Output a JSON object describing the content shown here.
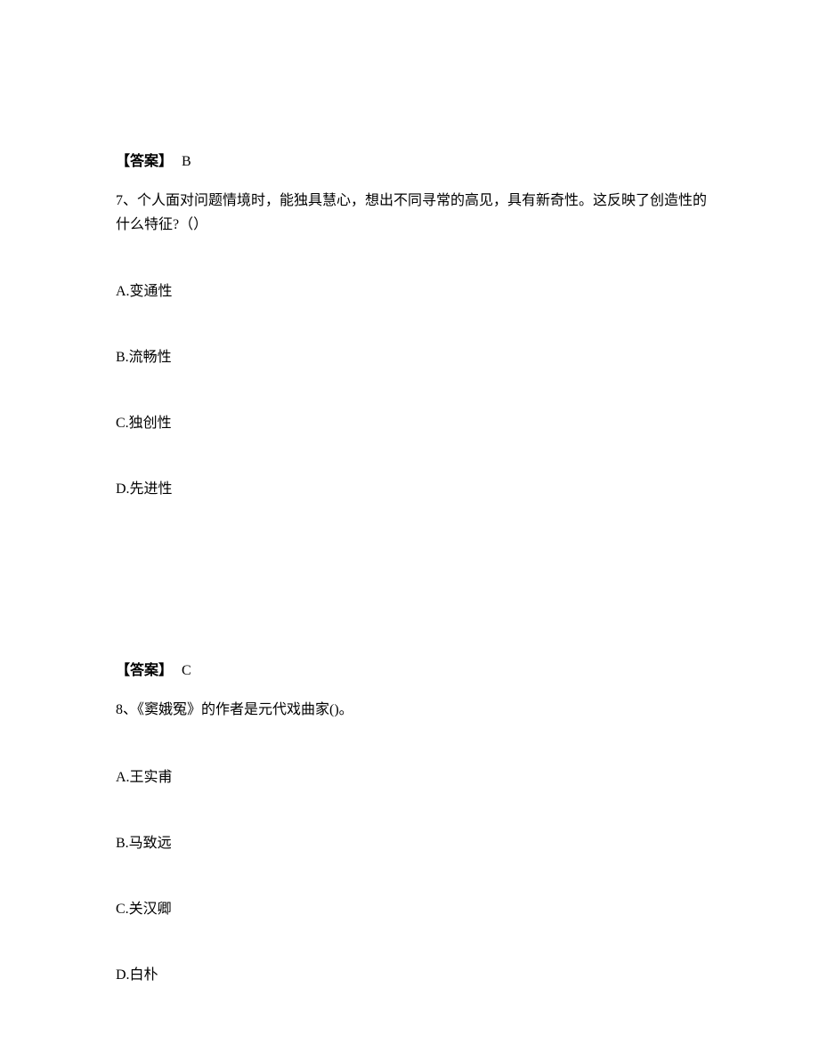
{
  "q7": {
    "prev_answer_label": "【答案】",
    "prev_answer_value": "B",
    "text": "7、个人面对问题情境时，能独具慧心，想出不同寻常的高见，具有新奇性。这反映了创造性的什么特征?（）",
    "options": {
      "a": "A.变通性",
      "b": "B.流畅性",
      "c": "C.独创性",
      "d": "D.先进性"
    },
    "answer_label": "【答案】",
    "answer_value": "C"
  },
  "q8": {
    "text": "8、《窦娥冤》的作者是元代戏曲家()。",
    "options": {
      "a": "A.王实甫",
      "b": "B.马致远",
      "c": "C.关汉卿",
      "d": "D.白朴"
    }
  }
}
